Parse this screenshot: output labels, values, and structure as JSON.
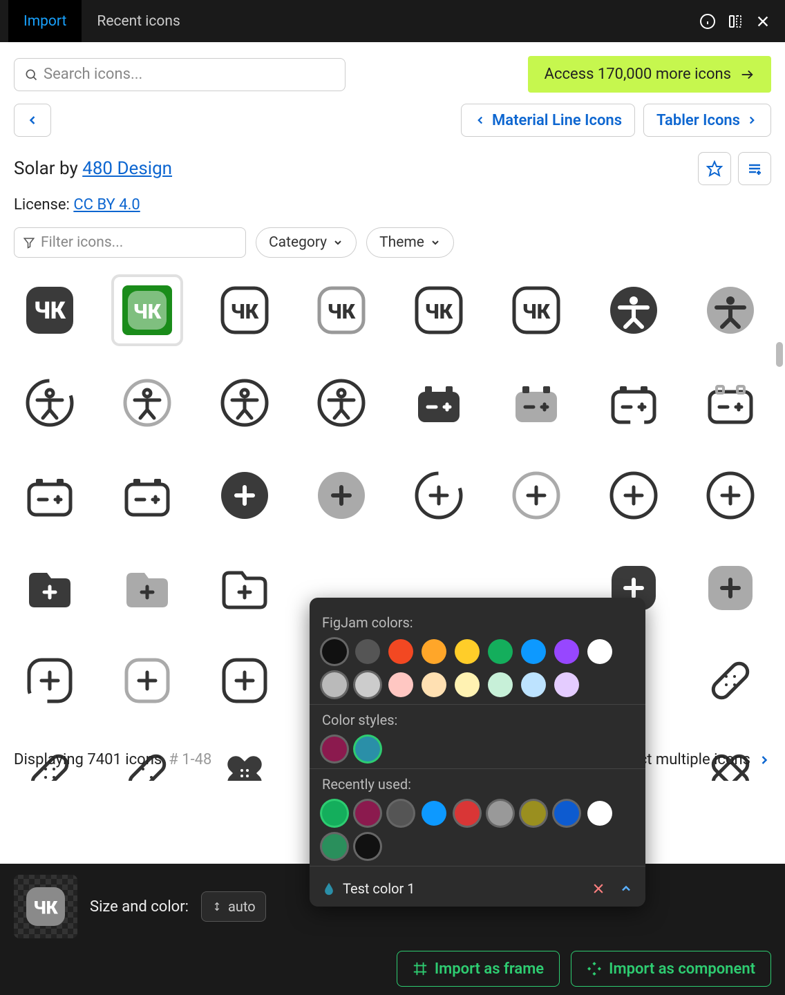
{
  "header": {
    "tabs": [
      "Import",
      "Recent icons"
    ]
  },
  "search": {
    "placeholder": "Search icons..."
  },
  "promo": {
    "label": "Access 170,000 more icons"
  },
  "nav": {
    "prev": "Material Line Icons",
    "next": "Tabler Icons"
  },
  "title": {
    "prefix": "Solar by ",
    "link": "480 Design"
  },
  "license": {
    "prefix": "License: ",
    "link": "CC BY 4.0"
  },
  "filter": {
    "placeholder": "Filter icons...",
    "category": "Category",
    "theme": "Theme"
  },
  "status": {
    "count": "Displaying 7401 icons",
    "range": "# 1-48",
    "select": "ct multiple icons"
  },
  "footer": {
    "label": "Size and color:",
    "size": "auto",
    "frame": "Import as frame",
    "component": "Import as component"
  },
  "colorPopup": {
    "s1": "FigJam colors:",
    "s2": "Color styles:",
    "s3": "Recently used:",
    "figjam": [
      "#111111",
      "#555555",
      "#f24822",
      "#ffa629",
      "#ffcd29",
      "#14ae5c",
      "#0d99ff",
      "#9747ff",
      "#ffffff",
      "#bababa",
      "#cccccc",
      "#ffc7c2",
      "#ffe0b2",
      "#fff2b2",
      "#c7f0d8",
      "#bde3ff",
      "#e4ccff"
    ],
    "styles": [
      "#8b1a4e",
      "#2a8fa8"
    ],
    "recent": [
      "#14ae5c",
      "#8b1a4e",
      "#555555",
      "#0d99ff",
      "#d93636",
      "#999999",
      "#9a8f1f",
      "#0d5bd0",
      "#ffffff",
      "#2a8f5c",
      "#111111"
    ],
    "testLabel": "Test color 1"
  }
}
